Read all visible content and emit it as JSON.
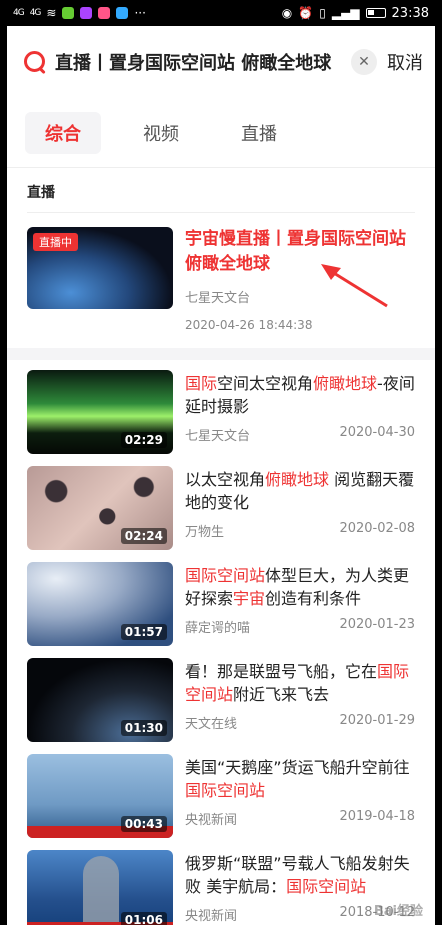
{
  "status_bar": {
    "signal_1": "4G",
    "signal_2": "4G",
    "time": "23:38"
  },
  "search": {
    "query": "直播丨置身国际空间站 俯瞰全地球",
    "cancel_label": "取消"
  },
  "tabs": [
    {
      "label": "综合",
      "active": true
    },
    {
      "label": "视频",
      "active": false
    },
    {
      "label": "直播",
      "active": false
    }
  ],
  "live": {
    "section_title": "直播",
    "badge": "直播中",
    "title": "宇宙慢直播丨置身国际空间站 俯瞰全地球",
    "author": "七星天文台",
    "datetime": "2020-04-26 18:44:38"
  },
  "results": [
    {
      "title_parts": [
        [
          "国际",
          true
        ],
        [
          "空间太空视角",
          false
        ],
        [
          "俯瞰地球",
          true
        ],
        [
          "-夜间延时摄影",
          false
        ]
      ],
      "duration": "02:29",
      "author": "七星天文台",
      "date": "2020-04-30"
    },
    {
      "title_parts": [
        [
          "以太空视角",
          false
        ],
        [
          "俯瞰地球",
          true
        ],
        [
          " 阅览翻天覆地的变化",
          false
        ]
      ],
      "duration": "02:24",
      "author": "万物生",
      "date": "2020-02-08"
    },
    {
      "title_parts": [
        [
          "国际空间站",
          true
        ],
        [
          "体型巨大，为人类更好探索",
          false
        ],
        [
          "宇宙",
          true
        ],
        [
          "创造有利条件",
          false
        ]
      ],
      "duration": "01:57",
      "author": "薛定谔的喵",
      "date": "2020-01-23"
    },
    {
      "title_parts": [
        [
          "看！那是联盟号飞船，它在",
          false
        ],
        [
          "国际空间站",
          true
        ],
        [
          "附近飞来飞去",
          false
        ]
      ],
      "duration": "01:30",
      "author": "天文在线",
      "date": "2020-01-29"
    },
    {
      "title_parts": [
        [
          "美国“天鹅座”货运飞船升空前往",
          false
        ],
        [
          "国际空间站",
          true
        ]
      ],
      "duration": "00:43",
      "author": "央视新闻",
      "date": "2019-04-18"
    },
    {
      "title_parts": [
        [
          "俄罗斯“联盟”号载人飞船发射失败 美宇航局：",
          false
        ],
        [
          "国际空间站",
          true
        ]
      ],
      "duration": "01:06",
      "author": "央视新闻",
      "date": "2018-10-12"
    }
  ],
  "watermark": "Bai经验",
  "colors": {
    "accent": "#e33333"
  }
}
